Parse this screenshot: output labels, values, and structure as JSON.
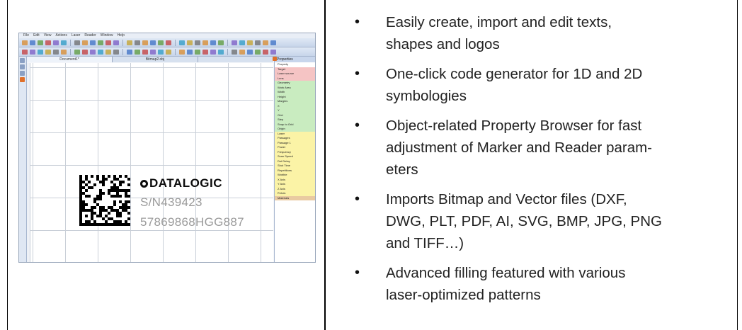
{
  "screenshot": {
    "menu": [
      "File",
      "Edit",
      "View",
      "Actions",
      "Laser",
      "Reader",
      "Window",
      "Help"
    ],
    "doc_tabs": [
      "Document1*",
      "Bitmap2.obj"
    ],
    "panel_title": "Properties",
    "property_rows": [
      {
        "label": "Property",
        "tone": "white"
      },
      {
        "label": "Target",
        "tone": "red"
      },
      {
        "label": "Laser source",
        "tone": "red"
      },
      {
        "label": "Lens",
        "tone": "red"
      },
      {
        "label": "Geometry",
        "tone": "green"
      },
      {
        "label": "Work Area",
        "tone": "green"
      },
      {
        "label": "Width",
        "tone": "green"
      },
      {
        "label": "Height",
        "tone": "green"
      },
      {
        "label": "Margins",
        "tone": "green"
      },
      {
        "label": "X",
        "tone": "green"
      },
      {
        "label": "Y",
        "tone": "green"
      },
      {
        "label": "Grid",
        "tone": "green"
      },
      {
        "label": "Step",
        "tone": "green"
      },
      {
        "label": "Snap to Grid",
        "tone": "green"
      },
      {
        "label": "Origin",
        "tone": "green"
      },
      {
        "label": "Laser",
        "tone": "yellow"
      },
      {
        "label": "Passages",
        "tone": "yellow"
      },
      {
        "label": "Passage 1",
        "tone": "yellow"
      },
      {
        "label": "Power",
        "tone": "yellow"
      },
      {
        "label": "Frequency",
        "tone": "yellow"
      },
      {
        "label": "Scan Speed",
        "tone": "yellow"
      },
      {
        "label": "Dot Delay",
        "tone": "yellow"
      },
      {
        "label": "Shot Time",
        "tone": "yellow"
      },
      {
        "label": "Repetitions",
        "tone": "yellow"
      },
      {
        "label": "Wobble",
        "tone": "yellow"
      },
      {
        "label": "X Axis",
        "tone": "yellow"
      },
      {
        "label": "Y Axis",
        "tone": "yellow"
      },
      {
        "label": "Z Axis",
        "tone": "yellow"
      },
      {
        "label": "R Axis",
        "tone": "yellow"
      },
      {
        "label": "Materials",
        "tone": "tan"
      }
    ],
    "logo_text": "DATALOGIC",
    "serial_text": "S/N439423",
    "code_text": "57869868HGG887"
  },
  "features": [
    "Easily create, import and edit texts, shapes and logos",
    "One-click code generator for 1D and 2D symbologies",
    "Object-related Property Browser for fast adjustment of Marker and Reader param-eters",
    "Imports Bitmap and Vector files (DXF, DWG, PLT, PDF, AI, SVG, BMP, JPG, PNG and TIFF…)",
    "Advanced filling featured with various laser-optimized patterns"
  ],
  "feature_lines": [
    [
      "Easily create, import and edit texts,",
      "shapes and logos"
    ],
    [
      "One-click code generator for 1D and 2D",
      "symbologies"
    ],
    [
      "Object-related Property Browser for fast",
      "adjustment of Marker and Reader param-",
      "eters"
    ],
    [
      "Imports Bitmap and Vector files (DXF,",
      "DWG, PLT, PDF, AI, SVG, BMP, JPG, PNG",
      "and TIFF…)"
    ],
    [
      "Advanced filling featured with various",
      "laser-optimized patterns"
    ]
  ],
  "bullet_glyph": "•",
  "colors": {
    "prop_red": "#f5c4c4",
    "prop_green": "#c9ecc0",
    "prop_yellow": "#fbf3a6",
    "prop_tan": "#e9caa1",
    "text": "#222222"
  }
}
